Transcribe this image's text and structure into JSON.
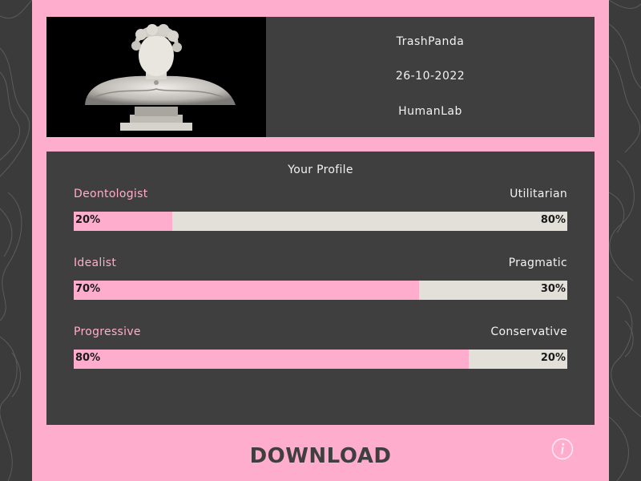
{
  "user": {
    "name": "TrashPanda",
    "date": "26-10-2022",
    "organization": "HumanLab"
  },
  "profile": {
    "title": "Your Profile",
    "traits": [
      {
        "left_label": "Deontologist",
        "right_label": "Utilitarian",
        "left_value": 20,
        "left_pct": "20%",
        "right_pct": "80%"
      },
      {
        "left_label": "Idealist",
        "right_label": "Pragmatic",
        "left_value": 70,
        "left_pct": "70%",
        "right_pct": "30%"
      },
      {
        "left_label": "Progressive",
        "right_label": "Conservative",
        "left_value": 80,
        "left_pct": "80%",
        "right_pct": "20%"
      }
    ]
  },
  "actions": {
    "download_label": "DOWNLOAD",
    "info_icon": "info-icon"
  },
  "colors": {
    "accent": "#ffadcc",
    "card": "#3f3f3f",
    "bar_track": "#e2e0d9",
    "background": "#3b3b3b"
  }
}
